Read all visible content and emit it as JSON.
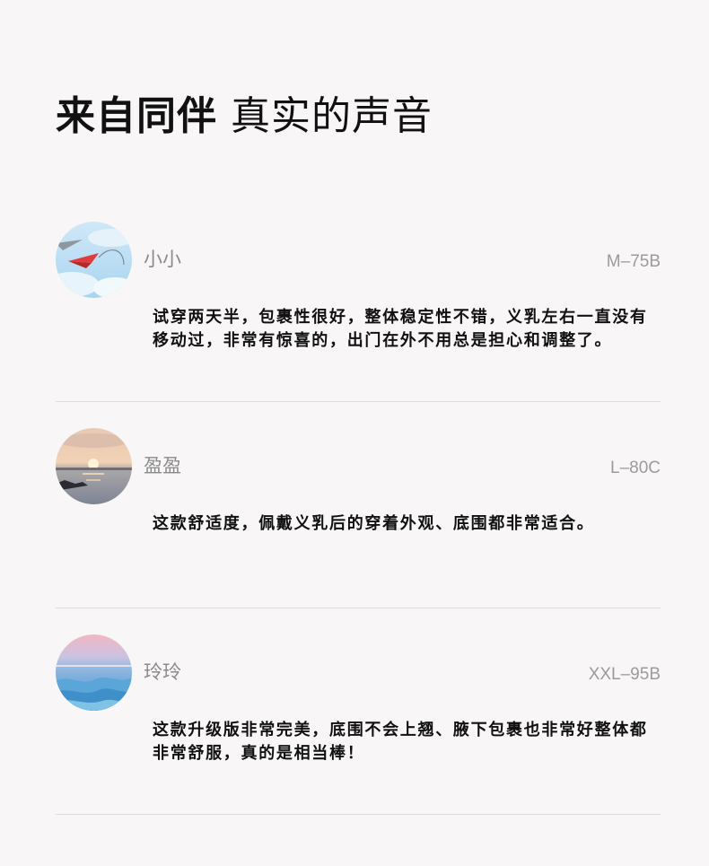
{
  "heading": {
    "bold": "来自同伴",
    "rest": " 真实的声音"
  },
  "reviews": [
    {
      "name": "小小",
      "size": "M–75B",
      "text": "试穿两天半，包裹性很好，整体稳定性不错，义乳左右一直没有移动过，非常有惊喜的，出门在外不用总是担心和调整了。"
    },
    {
      "name": "盈盈",
      "size": "L–80C",
      "text": "这款舒适度，佩戴义乳后的穿着外观、底围都非常适合。"
    },
    {
      "name": "玲玲",
      "size": "XXL–95B",
      "text": "这款升级版非常完美，底围不会上翘、腋下包裹也非常好整体都非常舒服，真的是相当棒！"
    }
  ]
}
